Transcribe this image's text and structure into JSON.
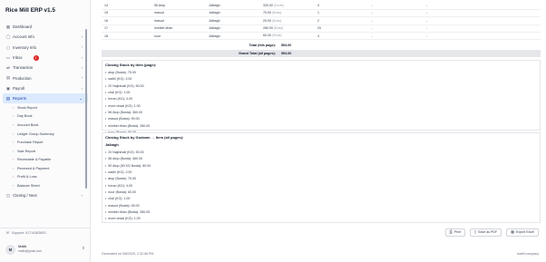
{
  "app": {
    "title": "Rice Mill ERP v1.5"
  },
  "sidebar": {
    "items": [
      {
        "label": "Dashboard",
        "icon": "grid-icon",
        "chevron": false
      },
      {
        "label": "Account Info",
        "icon": "person-icon",
        "chevron": true
      },
      {
        "label": "Inventory Info",
        "icon": "box-icon",
        "chevron": true
      },
      {
        "label": "Inbox",
        "icon": "inbox-icon",
        "chevron": true,
        "badge": "1"
      },
      {
        "label": "Transaction",
        "icon": "swap-icon",
        "chevron": true
      },
      {
        "label": "Production",
        "icon": "factory-icon",
        "chevron": true
      },
      {
        "label": "Payroll",
        "icon": "wallet-icon",
        "chevron": true
      },
      {
        "label": "Reports",
        "icon": "report-icon",
        "chevron": true,
        "active": true
      }
    ],
    "report_subitems": [
      {
        "label": "Stock Report",
        "icon": "doc-icon"
      },
      {
        "label": "Day Book",
        "icon": "book-icon"
      },
      {
        "label": "Account Book",
        "icon": "book-icon"
      },
      {
        "label": "Ledger Group Summary",
        "icon": "ledger-icon"
      },
      {
        "label": "Purchase Report",
        "icon": "cart-icon"
      },
      {
        "label": "Sale Report",
        "icon": "tag-icon"
      },
      {
        "label": "Receivable & Payable",
        "icon": "exchange-icon"
      },
      {
        "label": "Received & Payment",
        "icon": "payment-icon"
      },
      {
        "label": "Profit & Loss",
        "icon": "chart-icon"
      },
      {
        "label": "Balance Sheet",
        "icon": "scale-icon"
      }
    ],
    "closing_item": {
      "label": "Closing / Next",
      "icon": "lock-icon"
    },
    "support": "Support: 01714363693",
    "user": {
      "initial": "M",
      "name": "Malik",
      "email": "malik@gmail.com"
    }
  },
  "items_table": {
    "rows": [
      {
        "no": "14",
        "item": "56 Atop",
        "location": "Jalbagh",
        "rate": "320.00",
        "unit": "(Dozen)",
        "qty": "4",
        "a": "-",
        "b": "-"
      },
      {
        "no": "15",
        "item": "masud",
        "location": "Jalbagh",
        "rate": "70.00",
        "unit": "(Bosta)",
        "qty": "1",
        "a": "-",
        "b": "-"
      },
      {
        "no": "16",
        "item": "masud",
        "location": "Jalbagh",
        "rate": "20.00",
        "unit": "(Bosta)",
        "qty": "2",
        "a": "-",
        "b": "-"
      },
      {
        "no": "17",
        "item": "miniket dhan",
        "location": "Jalbagh",
        "rate": "280.00",
        "unit": "(Bosta)",
        "qty": "20",
        "a": "-",
        "b": "-"
      },
      {
        "no": "18",
        "item": "noor",
        "location": "Jalbagh",
        "rate": "60.00",
        "unit": "(Rosta)",
        "qty": "4",
        "a": "-",
        "b": "-"
      }
    ],
    "total_this_page_label": "Total (this page):",
    "total_this_page": "554.00",
    "grand_total_label": "Grand Total (all pages):",
    "grand_total": "554.00"
  },
  "closing_by_item": {
    "title": "Closing Stock by Item (page):",
    "lines": [
      "atop (Bosta): 75.00",
      "sadhi (KG): 2.00",
      "20 Najirshail (KG): 50.00",
      "chal (KG): 1.00",
      "Imran (KG): 4.00",
      "more chaal (KG): 1.00",
      "56 Atop (Bosta): 360.00",
      "masud (Bosta): 90.00",
      "miniket dhan (Bosta): 280.00",
      "noor (Bosta): 60.00"
    ]
  },
  "closing_by_godown": {
    "title": "Closing Stock by Godown → Item (all pages):",
    "godown": "Jalbagh",
    "lines": [
      "20 Najirshail (KG): 50.00",
      "56 Atop (Bosta): 360.00",
      "50 Atop (50 KG Bosta): 80.00",
      "sadhi (KG): 2.00",
      "atop (Bosta): 75.00",
      "Imran (KG): 4.00",
      "noor (Bosta): 60.00",
      "chal (KG): 1.00",
      "masud (Bosta): 90.00",
      "miniket dhan (Bosta): 280.00",
      "more chaal (KG): 1.00"
    ]
  },
  "actions": {
    "print": "Print",
    "save_pdf": "Save as PDF",
    "export_excel": "Export Excel"
  },
  "footer": {
    "generated": "Generated on 9/8/2025, 2:32:58 PM",
    "company": "mahil company"
  }
}
